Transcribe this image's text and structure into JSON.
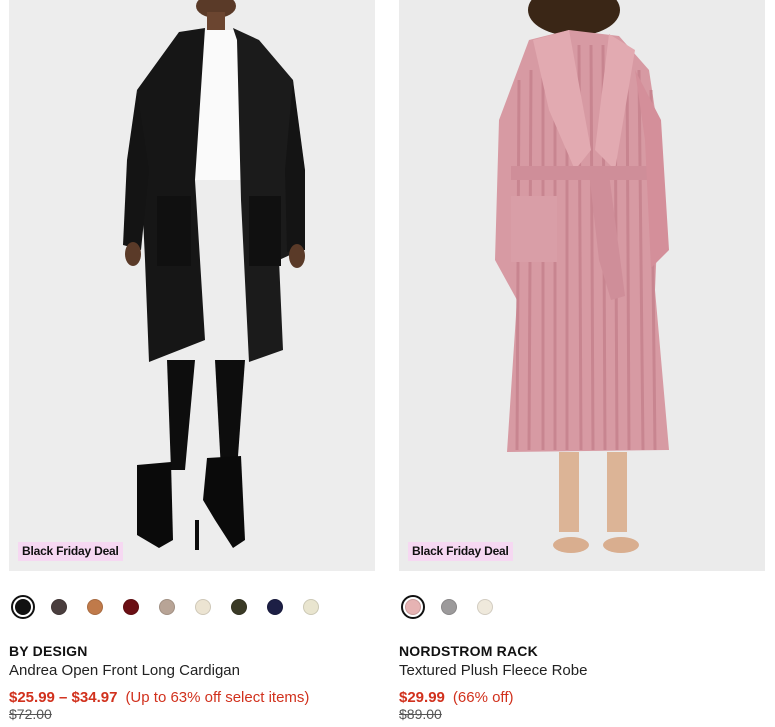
{
  "products": [
    {
      "badge": "Black Friday Deal",
      "image_alt": "Black open front long cardigan",
      "swatches": [
        "#111111",
        "#4a3e3e",
        "#c07a4a",
        "#6b0f14",
        "#b8a496",
        "#ece4d2",
        "#3a3a26",
        "#1d1f45",
        "#e9e5cf"
      ],
      "selected_swatch": 0,
      "brand": "BY DESIGN",
      "name": "Andrea Open Front Long Cardigan",
      "sale_price": "$25.99 – $34.97",
      "discount": "(Up to 63% off select items)",
      "original_price": "$72.00"
    },
    {
      "badge": "Black Friday Deal",
      "image_alt": "Pink textured plush fleece robe",
      "swatches": [
        "#e6b3b3",
        "#9c9a9b",
        "#efe9dc"
      ],
      "selected_swatch": 0,
      "brand": "NORDSTROM RACK",
      "name": "Textured Plush Fleece Robe",
      "sale_price": "$29.99",
      "discount": "(66% off)",
      "original_price": "$89.00"
    }
  ]
}
